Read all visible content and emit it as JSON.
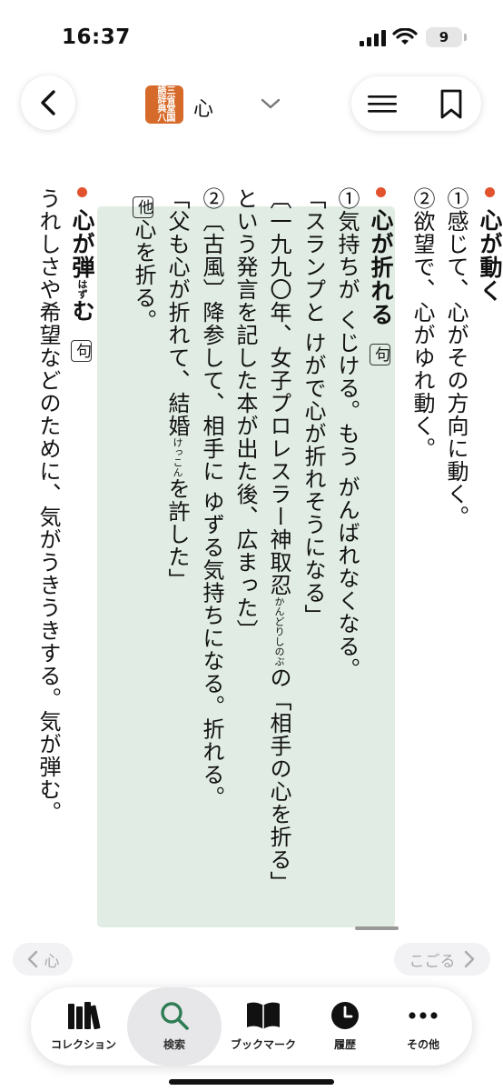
{
  "status": {
    "time": "16:37",
    "battery": "9"
  },
  "header": {
    "dict_icon_text": "三省堂国語辞典八",
    "title": "心"
  },
  "entries": {
    "e1": {
      "head": "心が動く",
      "lines": [
        "①感じて、心がその方向に動く。",
        "②欲望で、心がゆれ動く。"
      ]
    },
    "e2": {
      "head": "心が折れる",
      "tag": "句",
      "l1": "①気持ちが くじける。もう がんばれなくなる。",
      "l2": "「スランプと けがで心が折れそうになる」",
      "l3a": "〔一九九〇年、女子プロレスラー神取忍",
      "l3ruby": "かんどりしのぶ",
      "l3b": "の「相手の心を折る」",
      "l4": "という発言を記した本が出た後、広まった〕",
      "l5": "②〔古風〕降参して、相手に ゆずる気持ちになる。折れる。",
      "l6a": "「父も心が折れて、結婚",
      "l6ruby": "けっこん",
      "l6b": "を許した」",
      "l7tag": "他",
      "l7": "心を折る。"
    },
    "e3": {
      "head_a": "心が弾",
      "head_ruby": "はず",
      "head_b": "む",
      "tag": "句",
      "l1": "うれしさや希望などのために、気がうきうきする。気が弾む。"
    }
  },
  "nav": {
    "prev": "心",
    "next": "こごる"
  },
  "tabs": [
    {
      "label": "コレクション",
      "icon": "books-icon"
    },
    {
      "label": "検索",
      "icon": "search-icon"
    },
    {
      "label": "ブックマーク",
      "icon": "open-book-icon"
    },
    {
      "label": "履歴",
      "icon": "clock-icon"
    },
    {
      "label": "その他",
      "icon": "more-icon"
    }
  ]
}
